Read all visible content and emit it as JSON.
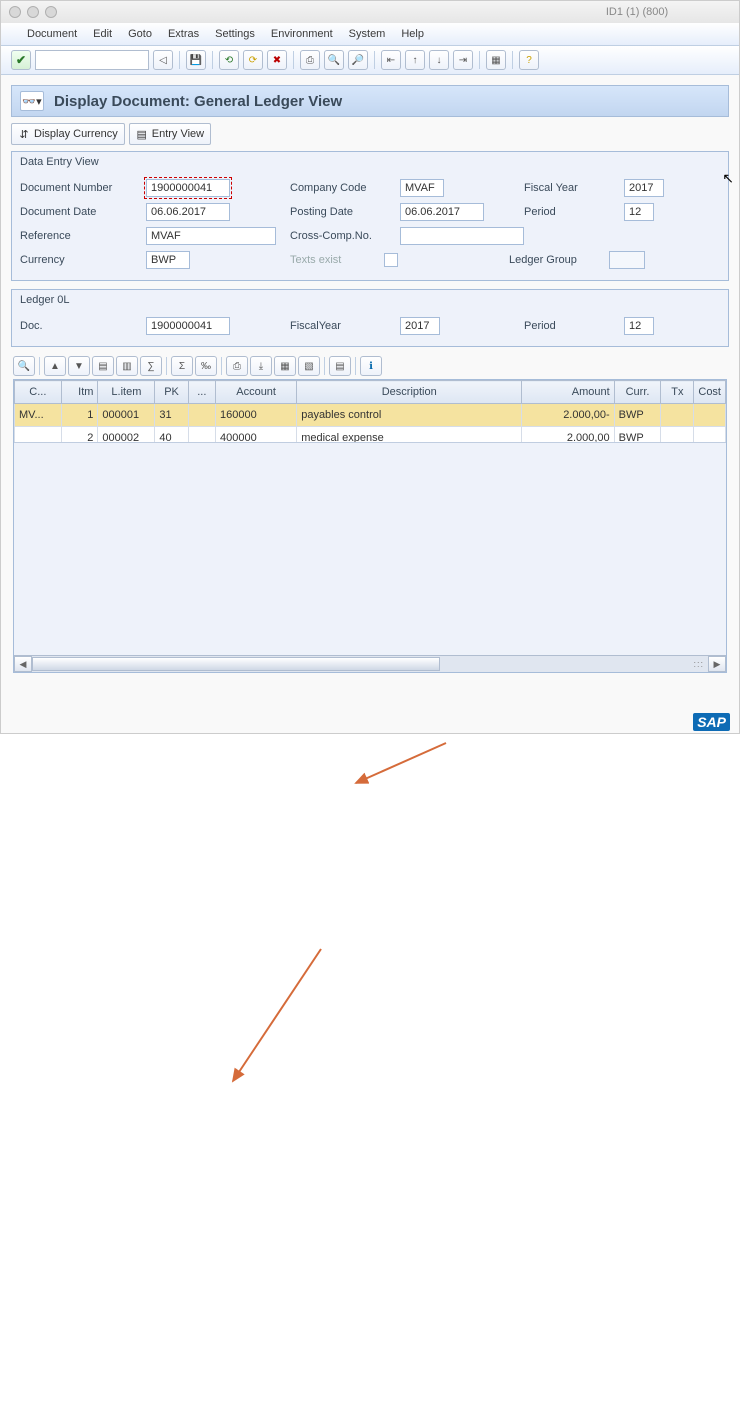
{
  "window": {
    "id_label": "ID1 (1) (800)"
  },
  "menubar": [
    "Document",
    "Edit",
    "Goto",
    "Extras",
    "Settings",
    "Environment",
    "System",
    "Help"
  ],
  "header": {
    "title": "Display Document: General Ledger View"
  },
  "buttons": {
    "display_currency": "Display Currency",
    "entry_view": "Entry View"
  },
  "data_entry": {
    "title": "Data Entry View",
    "labels": {
      "doc_no": "Document Number",
      "company": "Company Code",
      "fiscal_year": "Fiscal Year",
      "doc_date": "Document Date",
      "posting_date": "Posting Date",
      "period": "Period",
      "reference": "Reference",
      "cross": "Cross-Comp.No.",
      "currency": "Currency",
      "texts_exist": "Texts exist",
      "ledger_group": "Ledger Group"
    },
    "values": {
      "doc_no": "1900000041",
      "company": "MVAF",
      "fiscal_year": "2017",
      "doc_date": "06.06.2017",
      "posting_date": "06.06.2017",
      "period": "12",
      "reference": "MVAF",
      "cross": "",
      "currency": "BWP",
      "ledger_group": ""
    }
  },
  "ledger": {
    "title": "Ledger 0L",
    "labels": {
      "doc": "Doc.",
      "fiscal": "FiscalYear",
      "period": "Period"
    },
    "values": {
      "doc": "1900000041",
      "fiscal": "2017",
      "period": "12"
    }
  },
  "grid": {
    "colC": "C...",
    "colItm": "Itm",
    "colLitem": "L.item",
    "colPK": "PK",
    "colS": "...",
    "colAccount": "Account",
    "colDesc": "Description",
    "colAmount": "Amount",
    "colCurr": "Curr.",
    "colTx": "Tx",
    "colCost": "Cost",
    "rows": [
      {
        "c": "MV...",
        "itm": "1",
        "litem": "000001",
        "pk": "31",
        "s": "",
        "acct": "160000",
        "desc": "payables control",
        "amt": "2.000,00-",
        "curr": "BWP",
        "tx": "",
        "cost": ""
      },
      {
        "c": "",
        "itm": "2",
        "litem": "000002",
        "pk": "40",
        "s": "",
        "acct": "400000",
        "desc": "medical expense",
        "amt": "2.000,00",
        "curr": "BWP",
        "tx": "",
        "cost": ""
      }
    ]
  }
}
